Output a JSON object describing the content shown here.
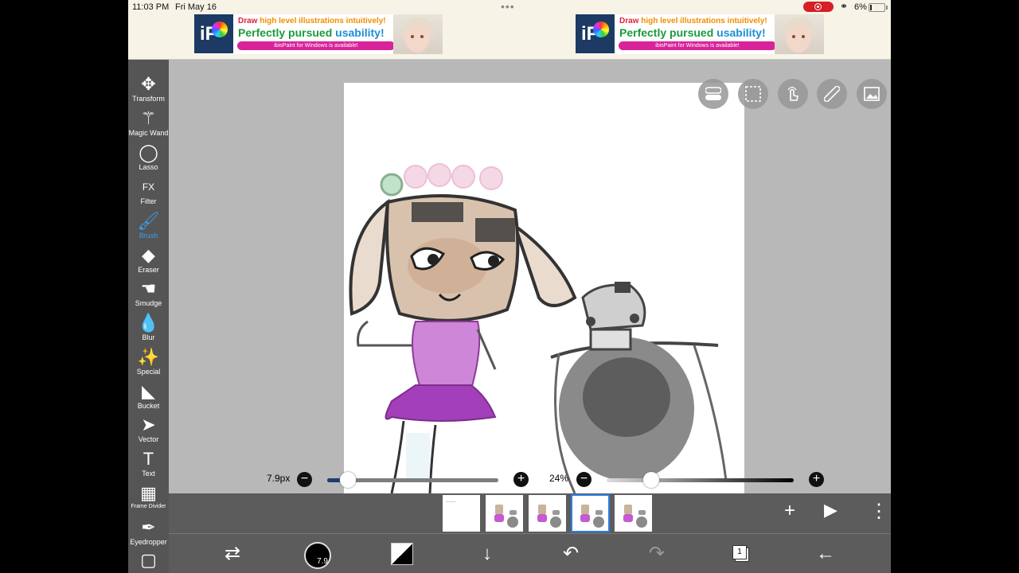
{
  "status_bar": {
    "time": "11:03 PM",
    "date": "Fri May 16",
    "battery": "6%"
  },
  "ads": [
    {
      "line1_a": "Draw ",
      "line1_b": "high level illustrations intuitively!",
      "line2_a": "Perfectly pursued ",
      "line2_b": "usability!",
      "line3": "ibisPaint for Windows is available!",
      "logo": "iP"
    },
    {
      "line1_a": "Draw ",
      "line1_b": "high level illustrations intuitively!",
      "line2_a": "Perfectly pursued ",
      "line2_b": "usability!",
      "line3": "ibisPaint for Windows is available!",
      "logo": "iP"
    }
  ],
  "toolbar": {
    "tools": [
      {
        "label": "Transform",
        "icon": "move-arrows-icon",
        "glyph": "✥"
      },
      {
        "label": "Magic Wand",
        "icon": "magic-wand-icon",
        "glyph": "⚚"
      },
      {
        "label": "Lasso",
        "icon": "lasso-icon",
        "glyph": "◯"
      },
      {
        "label": "Filter",
        "icon": "fx-filter-icon",
        "glyph": "FX"
      },
      {
        "label": "Brush",
        "icon": "brush-icon",
        "glyph": "🖌",
        "active": true
      },
      {
        "label": "Eraser",
        "icon": "eraser-icon",
        "glyph": "◆"
      },
      {
        "label": "Smudge",
        "icon": "smudge-icon",
        "glyph": "☚"
      },
      {
        "label": "Blur",
        "icon": "blur-drop-icon",
        "glyph": "💧"
      },
      {
        "label": "Special",
        "icon": "special-sparkle-icon",
        "glyph": "✨"
      },
      {
        "label": "Bucket",
        "icon": "bucket-icon",
        "glyph": "◣"
      },
      {
        "label": "Vector",
        "icon": "vector-cursor-icon",
        "glyph": "➤"
      },
      {
        "label": "Text",
        "icon": "text-t-icon",
        "glyph": "T"
      },
      {
        "label": "Frame Divider",
        "icon": "frame-divider-icon",
        "glyph": "▦"
      },
      {
        "label": "Eyedropper",
        "icon": "eyedropper-icon",
        "glyph": "✒"
      },
      {
        "label": "",
        "icon": "canvas-square-icon",
        "glyph": "▢"
      }
    ]
  },
  "canvas_buttons": [
    "toggle-settings-icon",
    "selection-rect-icon",
    "touch-hand-icon",
    "ruler-icon",
    "reference-image-icon"
  ],
  "brush": {
    "size_label": "7.9px",
    "size_value": 0.12,
    "opacity_label": "24%",
    "opacity_value": 0.24,
    "dot_label": "7.9"
  },
  "frames": {
    "count": 5,
    "selected_index": 3
  },
  "frame_controls": {
    "add": "+",
    "play": "▶",
    "more": "⋮"
  },
  "bottom_bar": {
    "layers_count": "1"
  }
}
